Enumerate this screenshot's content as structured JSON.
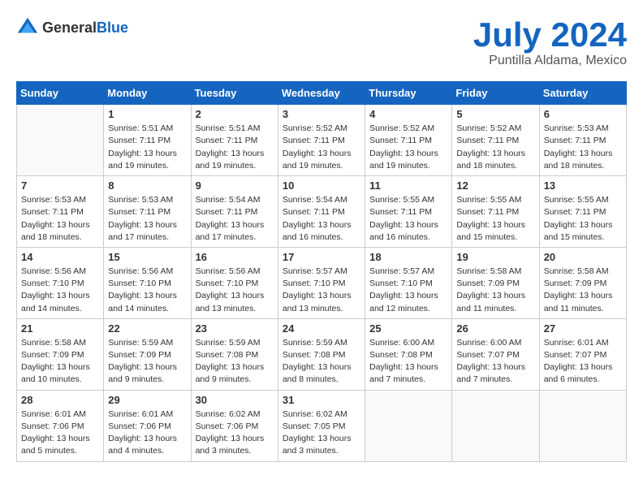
{
  "header": {
    "logo_general": "General",
    "logo_blue": "Blue",
    "month_year": "July 2024",
    "location": "Puntilla Aldama, Mexico"
  },
  "days_of_week": [
    "Sunday",
    "Monday",
    "Tuesday",
    "Wednesday",
    "Thursday",
    "Friday",
    "Saturday"
  ],
  "weeks": [
    [
      {
        "day": "",
        "sunrise": "",
        "sunset": "",
        "daylight": "",
        "empty": true
      },
      {
        "day": "1",
        "sunrise": "Sunrise: 5:51 AM",
        "sunset": "Sunset: 7:11 PM",
        "daylight": "Daylight: 13 hours and 19 minutes."
      },
      {
        "day": "2",
        "sunrise": "Sunrise: 5:51 AM",
        "sunset": "Sunset: 7:11 PM",
        "daylight": "Daylight: 13 hours and 19 minutes."
      },
      {
        "day": "3",
        "sunrise": "Sunrise: 5:52 AM",
        "sunset": "Sunset: 7:11 PM",
        "daylight": "Daylight: 13 hours and 19 minutes."
      },
      {
        "day": "4",
        "sunrise": "Sunrise: 5:52 AM",
        "sunset": "Sunset: 7:11 PM",
        "daylight": "Daylight: 13 hours and 19 minutes."
      },
      {
        "day": "5",
        "sunrise": "Sunrise: 5:52 AM",
        "sunset": "Sunset: 7:11 PM",
        "daylight": "Daylight: 13 hours and 18 minutes."
      },
      {
        "day": "6",
        "sunrise": "Sunrise: 5:53 AM",
        "sunset": "Sunset: 7:11 PM",
        "daylight": "Daylight: 13 hours and 18 minutes."
      }
    ],
    [
      {
        "day": "7",
        "sunrise": "Sunrise: 5:53 AM",
        "sunset": "Sunset: 7:11 PM",
        "daylight": "Daylight: 13 hours and 18 minutes."
      },
      {
        "day": "8",
        "sunrise": "Sunrise: 5:53 AM",
        "sunset": "Sunset: 7:11 PM",
        "daylight": "Daylight: 13 hours and 17 minutes."
      },
      {
        "day": "9",
        "sunrise": "Sunrise: 5:54 AM",
        "sunset": "Sunset: 7:11 PM",
        "daylight": "Daylight: 13 hours and 17 minutes."
      },
      {
        "day": "10",
        "sunrise": "Sunrise: 5:54 AM",
        "sunset": "Sunset: 7:11 PM",
        "daylight": "Daylight: 13 hours and 16 minutes."
      },
      {
        "day": "11",
        "sunrise": "Sunrise: 5:55 AM",
        "sunset": "Sunset: 7:11 PM",
        "daylight": "Daylight: 13 hours and 16 minutes."
      },
      {
        "day": "12",
        "sunrise": "Sunrise: 5:55 AM",
        "sunset": "Sunset: 7:11 PM",
        "daylight": "Daylight: 13 hours and 15 minutes."
      },
      {
        "day": "13",
        "sunrise": "Sunrise: 5:55 AM",
        "sunset": "Sunset: 7:11 PM",
        "daylight": "Daylight: 13 hours and 15 minutes."
      }
    ],
    [
      {
        "day": "14",
        "sunrise": "Sunrise: 5:56 AM",
        "sunset": "Sunset: 7:10 PM",
        "daylight": "Daylight: 13 hours and 14 minutes."
      },
      {
        "day": "15",
        "sunrise": "Sunrise: 5:56 AM",
        "sunset": "Sunset: 7:10 PM",
        "daylight": "Daylight: 13 hours and 14 minutes."
      },
      {
        "day": "16",
        "sunrise": "Sunrise: 5:56 AM",
        "sunset": "Sunset: 7:10 PM",
        "daylight": "Daylight: 13 hours and 13 minutes."
      },
      {
        "day": "17",
        "sunrise": "Sunrise: 5:57 AM",
        "sunset": "Sunset: 7:10 PM",
        "daylight": "Daylight: 13 hours and 13 minutes."
      },
      {
        "day": "18",
        "sunrise": "Sunrise: 5:57 AM",
        "sunset": "Sunset: 7:10 PM",
        "daylight": "Daylight: 13 hours and 12 minutes."
      },
      {
        "day": "19",
        "sunrise": "Sunrise: 5:58 AM",
        "sunset": "Sunset: 7:09 PM",
        "daylight": "Daylight: 13 hours and 11 minutes."
      },
      {
        "day": "20",
        "sunrise": "Sunrise: 5:58 AM",
        "sunset": "Sunset: 7:09 PM",
        "daylight": "Daylight: 13 hours and 11 minutes."
      }
    ],
    [
      {
        "day": "21",
        "sunrise": "Sunrise: 5:58 AM",
        "sunset": "Sunset: 7:09 PM",
        "daylight": "Daylight: 13 hours and 10 minutes."
      },
      {
        "day": "22",
        "sunrise": "Sunrise: 5:59 AM",
        "sunset": "Sunset: 7:09 PM",
        "daylight": "Daylight: 13 hours and 9 minutes."
      },
      {
        "day": "23",
        "sunrise": "Sunrise: 5:59 AM",
        "sunset": "Sunset: 7:08 PM",
        "daylight": "Daylight: 13 hours and 9 minutes."
      },
      {
        "day": "24",
        "sunrise": "Sunrise: 5:59 AM",
        "sunset": "Sunset: 7:08 PM",
        "daylight": "Daylight: 13 hours and 8 minutes."
      },
      {
        "day": "25",
        "sunrise": "Sunrise: 6:00 AM",
        "sunset": "Sunset: 7:08 PM",
        "daylight": "Daylight: 13 hours and 7 minutes."
      },
      {
        "day": "26",
        "sunrise": "Sunrise: 6:00 AM",
        "sunset": "Sunset: 7:07 PM",
        "daylight": "Daylight: 13 hours and 7 minutes."
      },
      {
        "day": "27",
        "sunrise": "Sunrise: 6:01 AM",
        "sunset": "Sunset: 7:07 PM",
        "daylight": "Daylight: 13 hours and 6 minutes."
      }
    ],
    [
      {
        "day": "28",
        "sunrise": "Sunrise: 6:01 AM",
        "sunset": "Sunset: 7:06 PM",
        "daylight": "Daylight: 13 hours and 5 minutes."
      },
      {
        "day": "29",
        "sunrise": "Sunrise: 6:01 AM",
        "sunset": "Sunset: 7:06 PM",
        "daylight": "Daylight: 13 hours and 4 minutes."
      },
      {
        "day": "30",
        "sunrise": "Sunrise: 6:02 AM",
        "sunset": "Sunset: 7:06 PM",
        "daylight": "Daylight: 13 hours and 3 minutes."
      },
      {
        "day": "31",
        "sunrise": "Sunrise: 6:02 AM",
        "sunset": "Sunset: 7:05 PM",
        "daylight": "Daylight: 13 hours and 3 minutes."
      },
      {
        "day": "",
        "sunrise": "",
        "sunset": "",
        "daylight": "",
        "empty": true
      },
      {
        "day": "",
        "sunrise": "",
        "sunset": "",
        "daylight": "",
        "empty": true
      },
      {
        "day": "",
        "sunrise": "",
        "sunset": "",
        "daylight": "",
        "empty": true
      }
    ]
  ]
}
